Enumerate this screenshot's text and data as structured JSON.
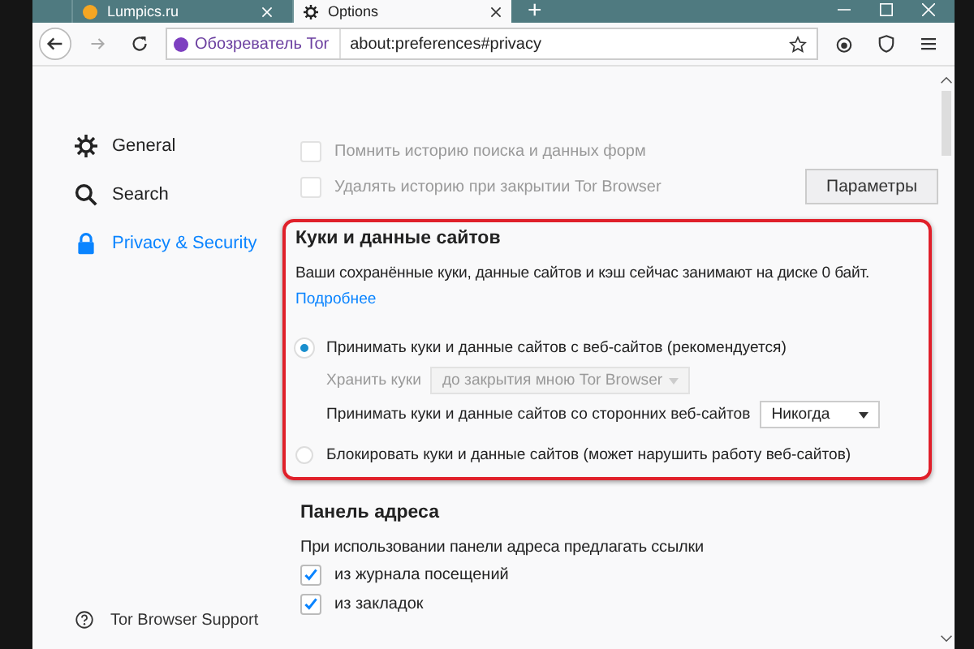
{
  "tabs": [
    {
      "label": "Lumpics.ru",
      "selected": false
    },
    {
      "label": "Options",
      "selected": true
    }
  ],
  "new_tab": "+",
  "address": {
    "identity": "Обозреватель Tor",
    "url": "about:preferences#privacy"
  },
  "sidebar": {
    "items": [
      {
        "label": "General",
        "selected": false
      },
      {
        "label": "Search",
        "selected": false
      },
      {
        "label": "Privacy & Security",
        "selected": true
      }
    ],
    "support": "Tor Browser Support"
  },
  "history": {
    "options": [
      {
        "label": "Помнить историю поиска и данных форм",
        "checked": false,
        "disabled": true
      },
      {
        "label": "Удалять историю при закрытии Tor Browser",
        "checked": false,
        "disabled": true
      }
    ],
    "button": "Параметры"
  },
  "cookies": {
    "title": "Куки и данные сайтов",
    "description": "Ваши сохранённые куки, данные сайтов и кэш сейчас занимают на диске 0 байт.",
    "link": "Подробнее",
    "accept": {
      "label": "Принимать куки и данные сайтов с веб-сайтов (рекомендуется)",
      "selected": true
    },
    "keep": {
      "label": "Хранить куки",
      "value": "до закрытия мною Tor Browser",
      "disabled": true
    },
    "third_party": {
      "label": "Принимать куки и данные сайтов со сторонних веб-сайтов",
      "value": "Никогда",
      "disabled": false
    },
    "block": {
      "label": "Блокировать куки и данные сайтов (может нарушить работу веб-сайтов)",
      "selected": false
    }
  },
  "address_bar": {
    "title": "Панель адреса",
    "description": "При использовании панели адреса предлагать ссылки",
    "options": [
      {
        "label": "из журнала посещений",
        "checked": true
      },
      {
        "label": "из закладок",
        "checked": true
      }
    ]
  }
}
